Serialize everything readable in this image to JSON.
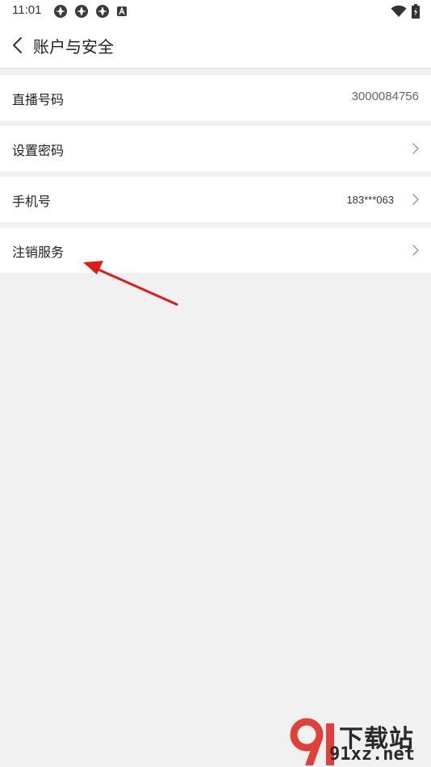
{
  "status_bar": {
    "time": "11:01",
    "left_icons": [
      "app-notification-icon",
      "app-notification-icon",
      "app-notification-icon",
      "a-badge-icon"
    ],
    "right_icons": [
      "wifi-icon",
      "battery-icon"
    ]
  },
  "header": {
    "title": "账户与安全",
    "back_icon": "chevron-left-icon"
  },
  "settings": [
    {
      "label": "直播号码",
      "value": "3000084756",
      "has_chevron": false
    },
    {
      "label": "设置密码",
      "value": "",
      "has_chevron": true
    },
    {
      "label": "手机号",
      "value": "183***063",
      "has_chevron": true
    },
    {
      "label": "注销服务",
      "value": "",
      "has_chevron": true
    }
  ],
  "annotation": {
    "color": "#e01b1b"
  },
  "watermark": {
    "line1": "下载站",
    "line2": "91xz.net",
    "logo_color": "#e0403a"
  },
  "colors": {
    "background": "#f1f1f1",
    "surface": "#ffffff",
    "divider": "#e4e4e4"
  }
}
